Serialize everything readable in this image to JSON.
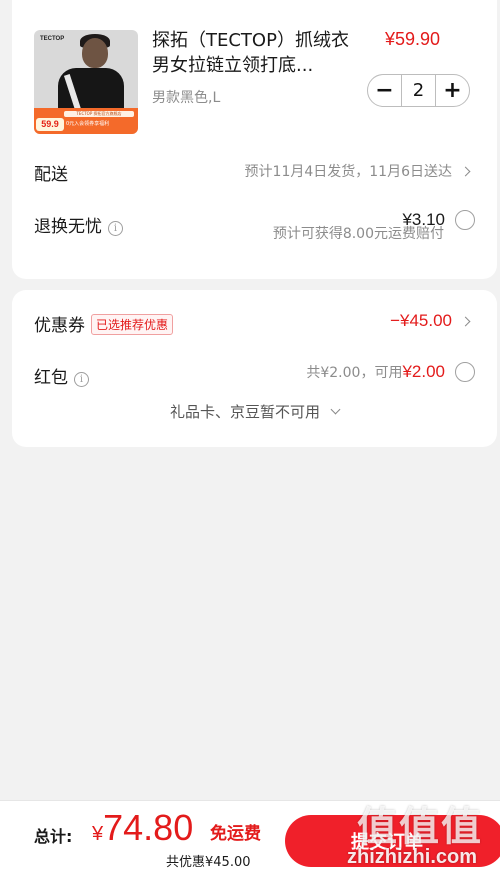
{
  "product": {
    "thumbnail": {
      "brand": "TECTOP",
      "promo_top": "TECTOP 探拓官方旗舰店",
      "promo_price": "59.9",
      "promo_text": "0元入会领券享福利"
    },
    "title": "探拓（TECTOP）抓绒衣男女拉链立领打底...",
    "price": "¥59.90",
    "spec": "男款黑色,L",
    "quantity": "2",
    "minus_symbol": "−",
    "plus_symbol": "+"
  },
  "delivery": {
    "label": "配送",
    "value": "预计11月4日发货，11月6日送达"
  },
  "return_insurance": {
    "label": "退换无忧",
    "info_symbol": "i",
    "fee": "¥3.10",
    "note": "预计可获得8.00元运费赔付"
  },
  "coupon": {
    "label": "优惠券",
    "tag": "已选推荐优惠",
    "amount": "−¥45.00"
  },
  "red_packet": {
    "label": "红包",
    "info_symbol": "i",
    "total": "共¥2.00，可用",
    "available": "¥2.00"
  },
  "giftcard": {
    "text": "礼品卡、京豆暂不可用"
  },
  "footer": {
    "total_label": "总计:",
    "currency": "¥",
    "total_amount": "74.80",
    "free_shipping": "免运费",
    "saved": "共优惠¥45.00",
    "submit": "提交订单"
  },
  "watermark": {
    "logo": "值值值",
    "url": "zhizhizhi.com"
  },
  "colors": {
    "accent_red": "#e31b1b",
    "button_red": "#f0202a",
    "background": "#f2f2f2"
  }
}
